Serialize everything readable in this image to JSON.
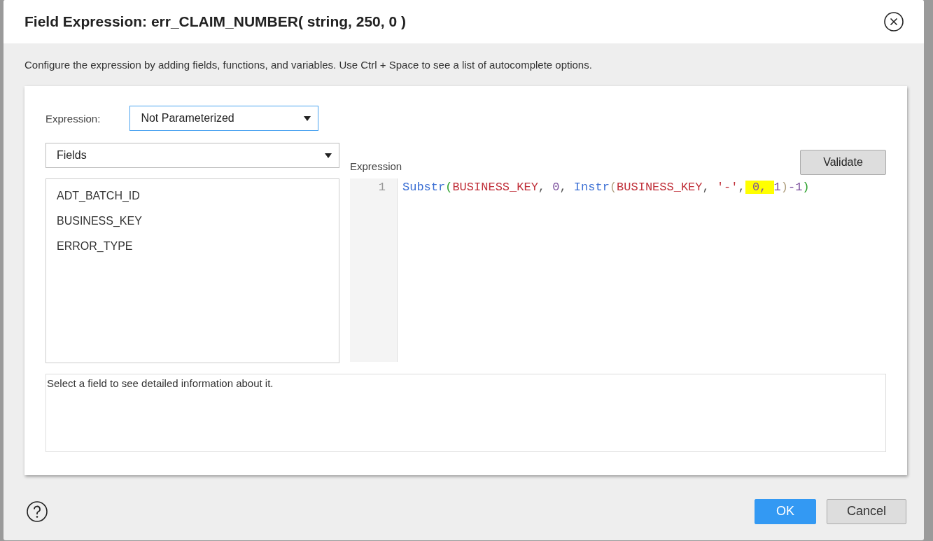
{
  "dialog": {
    "title": "Field Expression: err_CLAIM_NUMBER( string, 250, 0 )",
    "description": "Configure the expression by adding fields, functions, and variables. Use Ctrl + Space to see a list of autocomplete options."
  },
  "expression_mode": {
    "label": "Expression:",
    "value": "Not Parameterized"
  },
  "source_dropdown": {
    "value": "Fields"
  },
  "fields": [
    {
      "label": "ADT_BATCH_ID",
      "selected": false
    },
    {
      "label": "BUSINESS_KEY",
      "selected": false
    },
    {
      "label": "ERROR_TYPE",
      "selected": false
    }
  ],
  "editor": {
    "label": "Expression",
    "validate_button": "Validate",
    "lines": [
      {
        "number": "1",
        "tokens": [
          {
            "text": "Substr",
            "kind": "function",
            "highlighted": false
          },
          {
            "text": "(",
            "kind": "paren1",
            "highlighted": false
          },
          {
            "text": "BUSINESS_KEY",
            "kind": "field",
            "highlighted": false
          },
          {
            "text": ", ",
            "kind": "punct",
            "highlighted": false
          },
          {
            "text": "0",
            "kind": "number",
            "highlighted": false
          },
          {
            "text": ", ",
            "kind": "punct",
            "highlighted": false
          },
          {
            "text": "Instr",
            "kind": "function",
            "highlighted": false
          },
          {
            "text": "(",
            "kind": "paren2",
            "highlighted": false
          },
          {
            "text": "BUSINESS_KEY",
            "kind": "field",
            "highlighted": false
          },
          {
            "text": ", ",
            "kind": "punct",
            "highlighted": false
          },
          {
            "text": "'-'",
            "kind": "string",
            "highlighted": false
          },
          {
            "text": ",",
            "kind": "punct",
            "highlighted": false
          },
          {
            "text": " 0, ",
            "kind": "number",
            "highlighted": true
          },
          {
            "text": "1",
            "kind": "number",
            "highlighted": false
          },
          {
            "text": ")",
            "kind": "paren2",
            "highlighted": false
          },
          {
            "text": "-1",
            "kind": "number",
            "highlighted": false
          },
          {
            "text": ")",
            "kind": "paren1",
            "highlighted": false
          }
        ]
      }
    ]
  },
  "info_text": "Select a field to see detailed information about it.",
  "buttons": [
    {
      "label": "OK",
      "kind": "primary"
    },
    {
      "label": "Cancel",
      "kind": "secondary"
    }
  ]
}
